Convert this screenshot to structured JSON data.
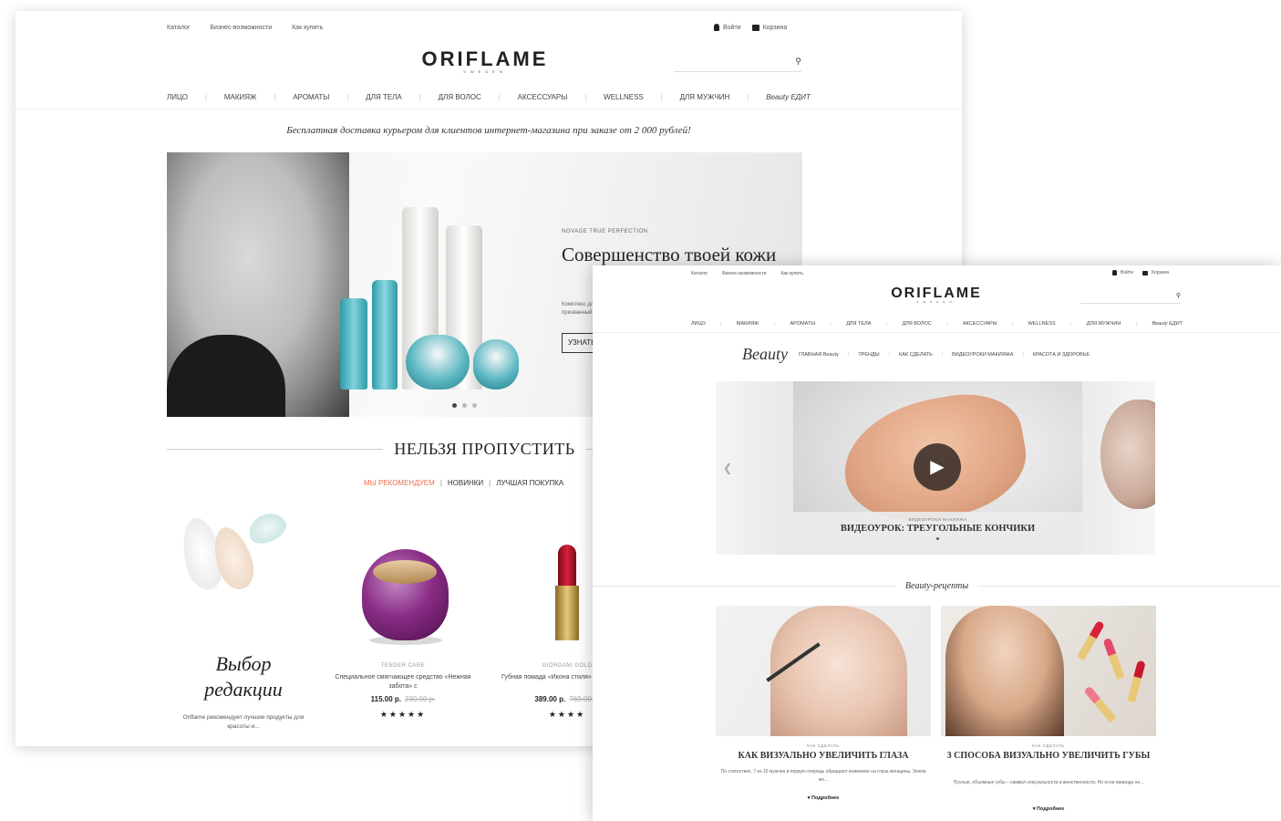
{
  "back_page": {
    "utility_left": [
      "Каталог",
      "Бизнес-возможности",
      "Как купить"
    ],
    "utility_right": {
      "login": "Войти",
      "cart": "Корзина"
    },
    "logo": {
      "main": "ORIFLAME",
      "sub": "SWEDEN"
    },
    "search": {
      "placeholder": "",
      "icon": "search-icon"
    },
    "categories": [
      "ЛИЦО",
      "МАКИЯЖ",
      "АРОМАТЫ",
      "ДЛЯ ТЕЛА",
      "ДЛЯ ВОЛОС",
      "АКСЕССУАРЫ",
      "WELLNESS",
      "ДЛЯ МУЖЧИН",
      "Beauty ЕДИТ"
    ],
    "promo": "Бесплатная доставка курьером для клиентов интернет-магазина при заказе от 2 000 рублей!",
    "hero": {
      "kicker": "NOVAGE TRUE PERFECTION",
      "headline": "Совершенство твоей кожи",
      "description": "Комплекс для идеальной кожи, призванный",
      "cta": "УЗНАТЬ БОЛЬШЕ"
    },
    "section_title": "НЕЛЬЗЯ ПРОПУСТИТЬ",
    "subtabs": [
      "МЫ РЕКОМЕНДУЕМ",
      "НОВИНКИ",
      "ЛУЧШАЯ ПОКУПКА"
    ],
    "editor": {
      "title_line1": "Выбор",
      "title_line2": "редакции",
      "text": "Oriflame рекомендует лучшие продукты для красоты и..."
    },
    "products": [
      {
        "brand": "TENDER CARE",
        "name": "Специальное смягчающее средство «Нежная забота» с",
        "price": "115.00 р.",
        "old_price": "230.00 р.",
        "stars": "★★★★★"
      },
      {
        "brand": "GIORDANI GOLD",
        "name": "Губная помада «Икона стиля» Giordani Gold",
        "price": "389.00 р.",
        "old_price": "769.00 р.",
        "stars": "★★★★"
      }
    ]
  },
  "front_page": {
    "utility_left": [
      "Каталог",
      "Бизнес-возможности",
      "Как купить"
    ],
    "utility_right": {
      "login": "Войти",
      "cart": "Корзина"
    },
    "logo": {
      "main": "ORIFLAME",
      "sub": "SWEDEN"
    },
    "categories": [
      "ЛИЦО",
      "МАКИЯЖ",
      "АРОМАТЫ",
      "ДЛЯ ТЕЛА",
      "ДЛЯ ВОЛОС",
      "АКСЕССУАРЫ",
      "WELLNESS",
      "ДЛЯ МУЖЧИН",
      "Beauty ЕДИТ"
    ],
    "beauty_nav": {
      "script_logo": "Beauty",
      "items": [
        "ГЛАВНАЯ Beauty",
        "ТРЕНДЫ",
        "КАК СДЕЛАТЬ",
        "ВИДЕОУРОКИ МАКИЯЖА",
        "КРАСОТА И ЗДОРОВЬЕ"
      ]
    },
    "video": {
      "kicker": "ВИДЕОУРОКИ МАКИЯЖА",
      "caption": "ВИДЕОУРОК: ТРЕУГОЛЬНЫЕ КОНЧИКИ",
      "play_icon": "play-icon"
    },
    "beauty_section_title": "Beauty-рецепты",
    "articles": [
      {
        "kicker": "КАК СДЕЛАТЬ",
        "headline": "КАК ВИЗУАЛЬНО УВЕЛИЧИТЬ ГЛАЗА",
        "body": "По статистике, 7 из 10 мужчин в первую очередь обращают внимание на глаза женщины. Зачем же...",
        "more": "▾ Подробнее"
      },
      {
        "kicker": "КАК СДЕЛАТЬ",
        "headline": "3 СПОСОБА ВИЗУАЛЬНО УВЕЛИЧИТЬ ГУБЫ",
        "body": "Пухлые, объемные губы – символ сексуальности и женственности. Но если природа не...",
        "more": "▾ Подробнее"
      }
    ]
  },
  "colors": {
    "accent_tab": "#e8734a",
    "text_dark": "#222222"
  }
}
